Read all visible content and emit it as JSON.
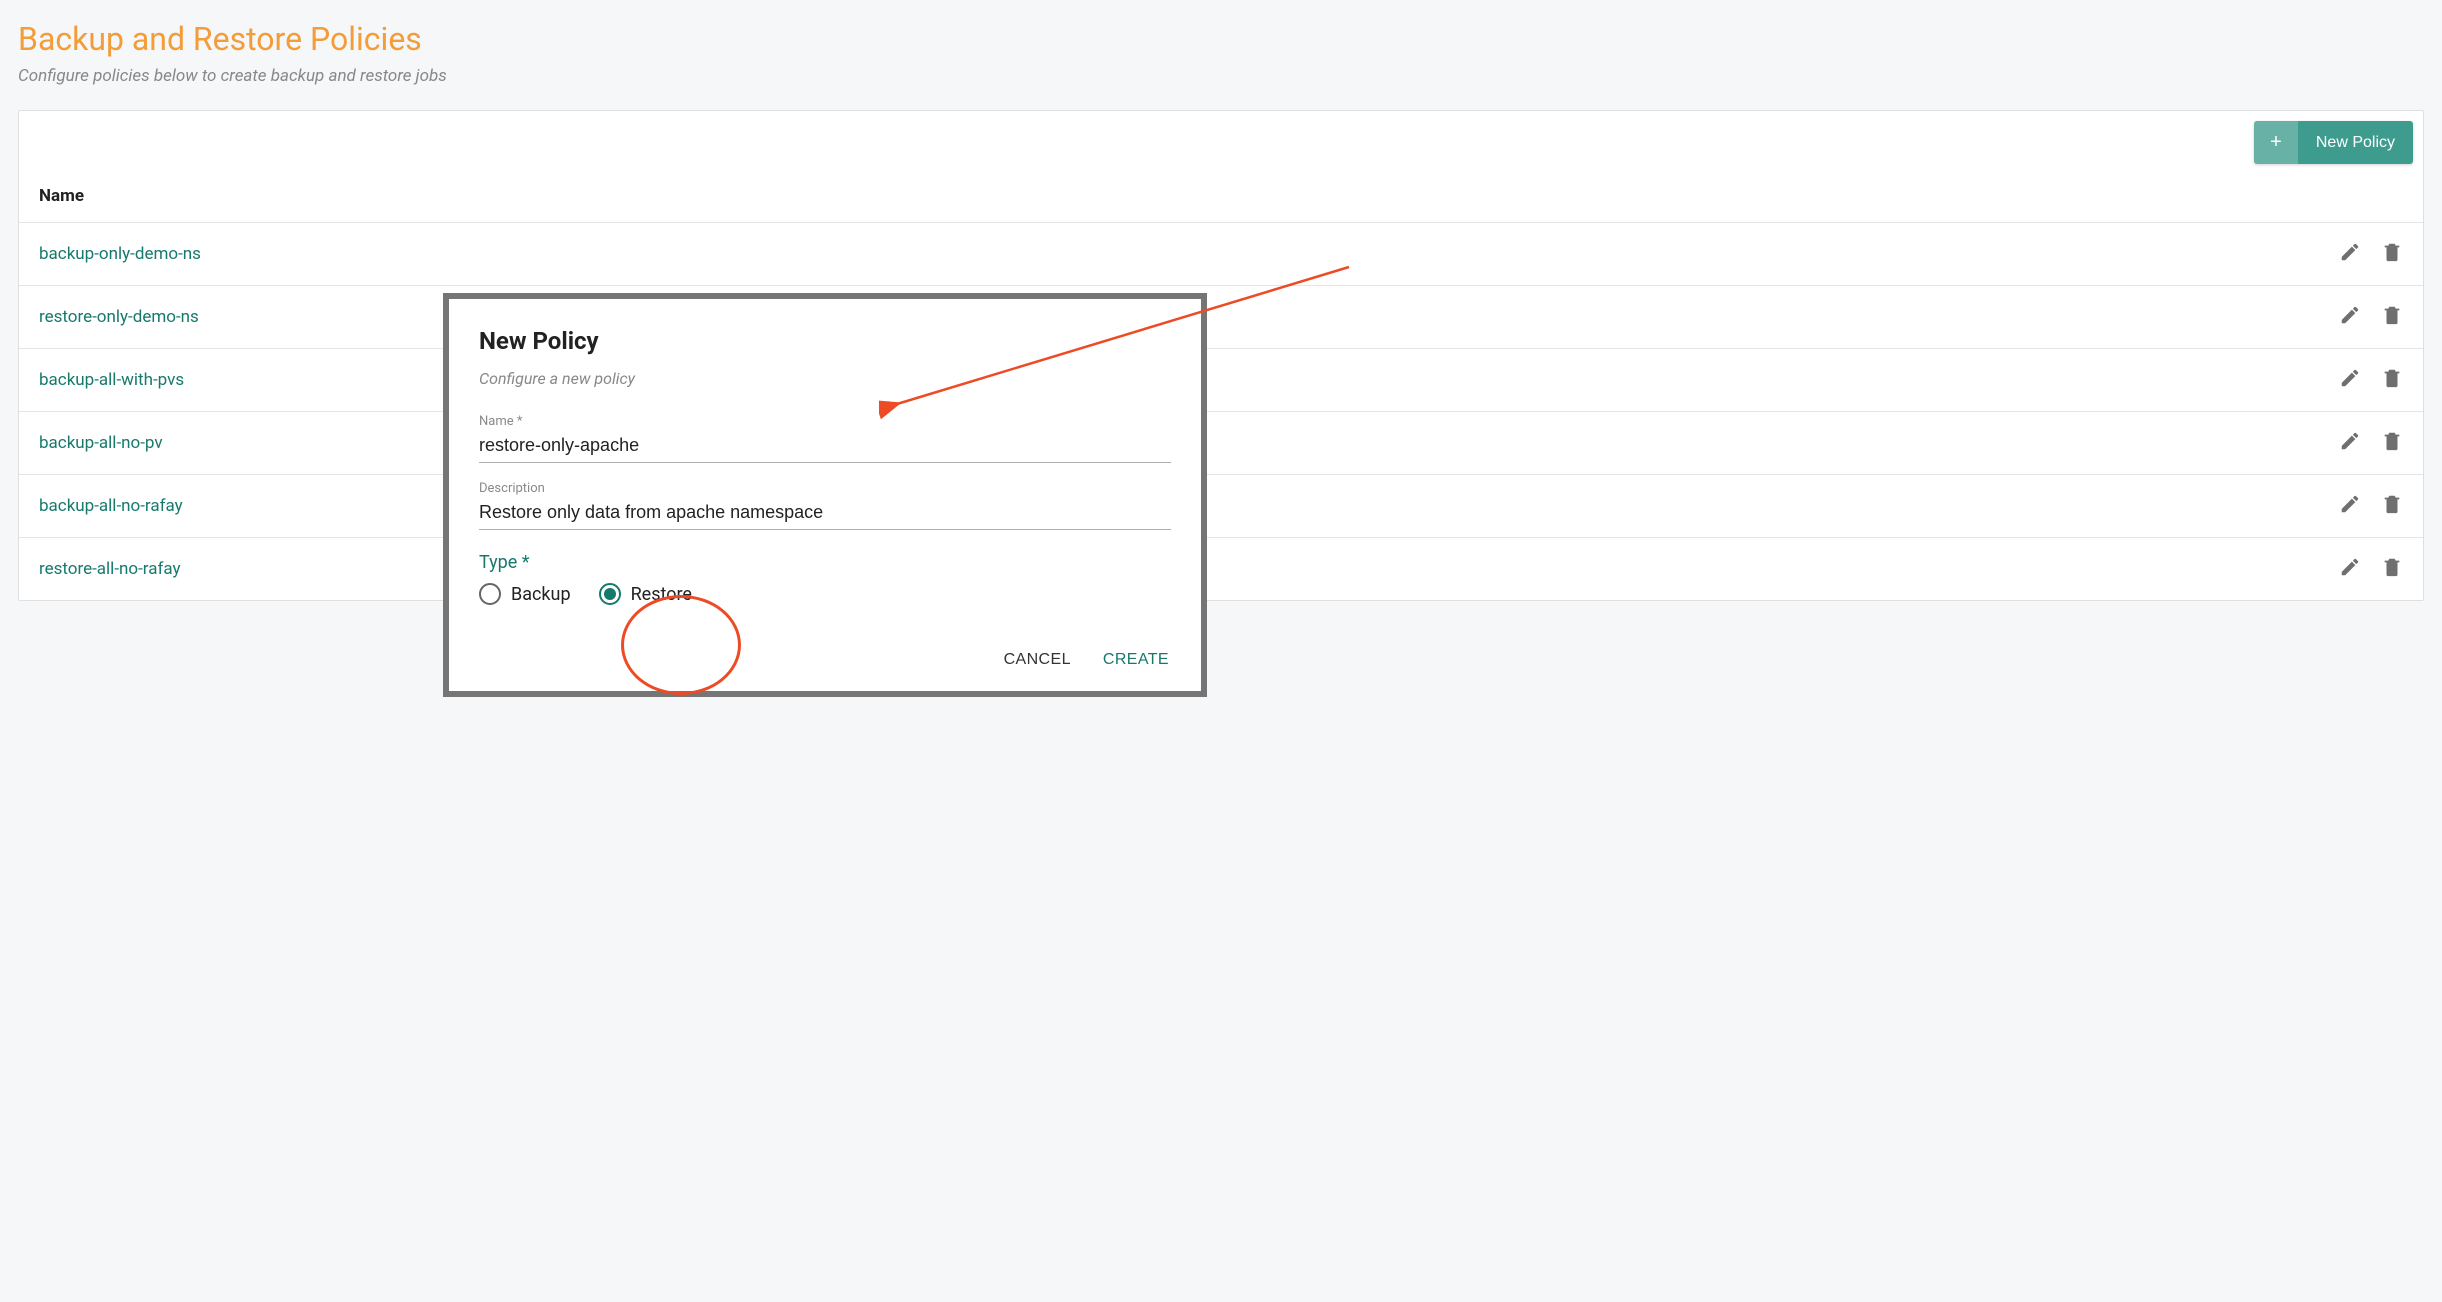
{
  "page": {
    "title": "Backup and Restore Policies",
    "subtitle": "Configure policies below to create backup and restore jobs"
  },
  "toolbar": {
    "new_policy_label": "New Policy"
  },
  "table": {
    "header_name": "Name",
    "rows": [
      {
        "name": "backup-only-demo-ns"
      },
      {
        "name": "restore-only-demo-ns"
      },
      {
        "name": "backup-all-with-pvs"
      },
      {
        "name": "backup-all-no-pv"
      },
      {
        "name": "backup-all-no-rafay"
      },
      {
        "name": "restore-all-no-rafay"
      }
    ]
  },
  "modal": {
    "title": "New Policy",
    "subtitle": "Configure a new policy",
    "name_label": "Name *",
    "name_value": "restore-only-apache",
    "description_label": "Description",
    "description_value": "Restore only data from apache namespace",
    "type_label": "Type *",
    "radio_backup": "Backup",
    "radio_restore": "Restore",
    "selected_type": "Restore",
    "cancel_label": "CANCEL",
    "create_label": "CREATE"
  }
}
